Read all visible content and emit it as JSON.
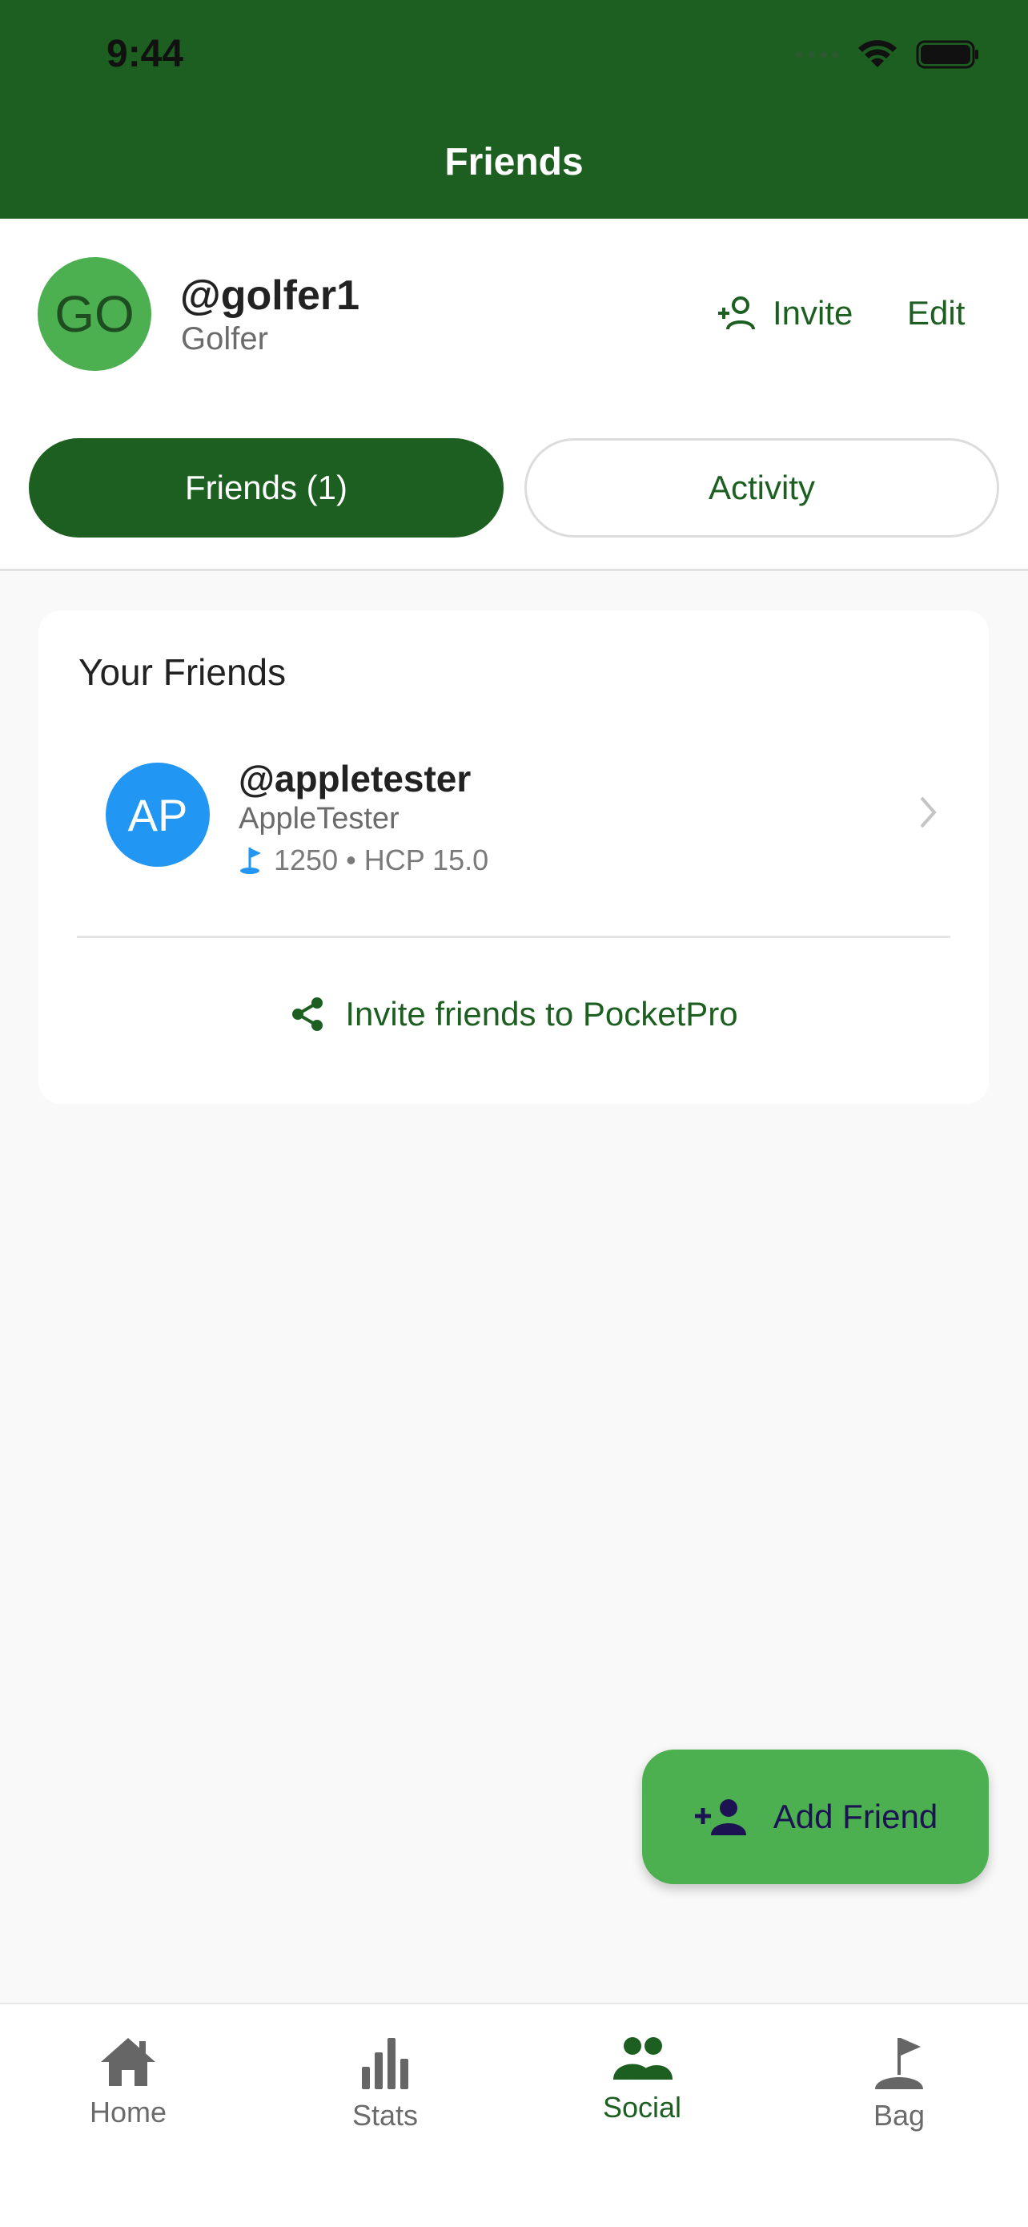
{
  "status_bar": {
    "time": "9:44"
  },
  "header": {
    "title": "Friends"
  },
  "profile": {
    "initials": "GO",
    "handle": "@golfer1",
    "subtitle": "Golfer",
    "invite_label": "Invite",
    "edit_label": "Edit"
  },
  "tabs": [
    {
      "label": "Friends (1)",
      "active": true
    },
    {
      "label": "Activity",
      "active": false
    }
  ],
  "friends_card": {
    "title": "Your Friends",
    "friends": [
      {
        "initials": "AP",
        "handle": "@appletester",
        "name": "AppleTester",
        "points": "1250",
        "separator": "•",
        "hcp": "HCP 15.0"
      }
    ],
    "invite_link": "Invite friends to PocketPro"
  },
  "fab": {
    "label": "Add Friend"
  },
  "bottom_nav": [
    {
      "label": "Home",
      "icon": "home-icon",
      "active": false
    },
    {
      "label": "Stats",
      "icon": "stats-icon",
      "active": false
    },
    {
      "label": "Social",
      "icon": "social-icon",
      "active": true
    },
    {
      "label": "Bag",
      "icon": "bag-icon",
      "active": false
    }
  ],
  "colors": {
    "brand_green": "#1d5f21",
    "accent_green": "#4caf50",
    "avatar_blue": "#2196f3",
    "fab_text": "#1c1452"
  }
}
